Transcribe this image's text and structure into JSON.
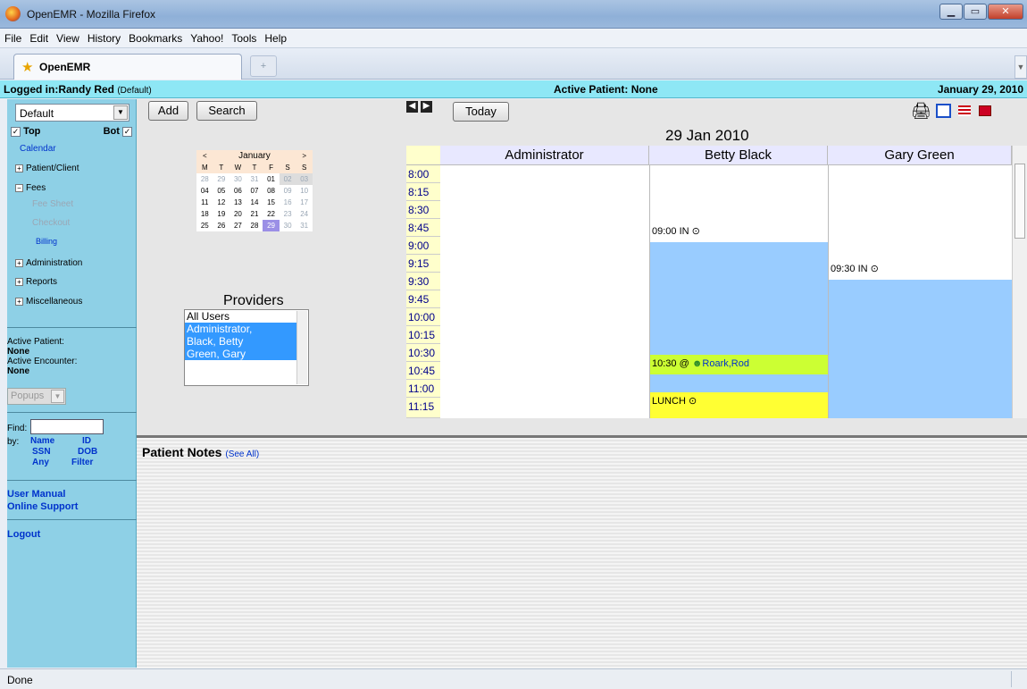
{
  "window": {
    "title": "OpenEMR - Mozilla Firefox"
  },
  "menu": [
    "File",
    "Edit",
    "View",
    "History",
    "Bookmarks",
    "Yahoo!",
    "Tools",
    "Help"
  ],
  "tab": {
    "label": "OpenEMR"
  },
  "login": {
    "user": "Logged in:Randy Red",
    "group": "(Default)",
    "active_patient": "Active Patient: None",
    "date": "January 29, 2010"
  },
  "sidebar": {
    "select_value": "Default",
    "top_label": "Top",
    "bot_label": "Bot",
    "items": {
      "calendar": "Calendar",
      "patient": "Patient/Client",
      "fees": "Fees",
      "fee_sheet": "Fee Sheet",
      "checkout": "Checkout",
      "billing": "Billing",
      "administration": "Administration",
      "reports": "Reports",
      "misc": "Miscellaneous"
    },
    "active_patient_label": "Active Patient:",
    "active_patient_value": "None",
    "active_encounter_label": "Active Encounter:",
    "active_encounter_value": "None",
    "popups": "Popups",
    "find_label": "Find:",
    "by_label": "by:",
    "find_links": [
      "Name",
      "ID",
      "SSN",
      "DOB",
      "Any",
      "Filter"
    ],
    "user_manual": "User Manual",
    "online_support": "Online Support",
    "logout": "Logout"
  },
  "toolbar": {
    "add": "Add",
    "search": "Search",
    "today": "Today"
  },
  "minical": {
    "month": "January",
    "prev": "<",
    "next": ">",
    "days": [
      "M",
      "T",
      "W",
      "T",
      "F",
      "S",
      "S"
    ],
    "weeks": [
      [
        "28",
        "29",
        "30",
        "31",
        "01",
        "02",
        "03"
      ],
      [
        "04",
        "05",
        "06",
        "07",
        "08",
        "09",
        "10"
      ],
      [
        "11",
        "12",
        "13",
        "14",
        "15",
        "16",
        "17"
      ],
      [
        "18",
        "19",
        "20",
        "21",
        "22",
        "23",
        "24"
      ],
      [
        "25",
        "26",
        "27",
        "28",
        "29",
        "30",
        "31"
      ]
    ]
  },
  "providers": {
    "title": "Providers",
    "list": [
      "All Users",
      "Administrator,",
      "Black, Betty",
      "Green, Gary"
    ]
  },
  "calendar": {
    "date_title": "29 Jan 2010",
    "columns": [
      "Administrator",
      "Betty Black",
      "Gary Green"
    ],
    "times": [
      "8:00",
      "8:15",
      "8:30",
      "8:45",
      "9:00",
      "9:15",
      "9:30",
      "9:45",
      "10:00",
      "10:15",
      "10:30",
      "10:45",
      "11:00",
      "11:15"
    ],
    "events": {
      "bb_in": "09:00 IN",
      "gg_in": "09:30 IN",
      "appt": "10:30 @",
      "appt_patient": "Roark,Rod",
      "lunch": "LUNCH"
    }
  },
  "notes": {
    "title": "Patient Notes",
    "see_all": "(See All)"
  },
  "status": "Done"
}
